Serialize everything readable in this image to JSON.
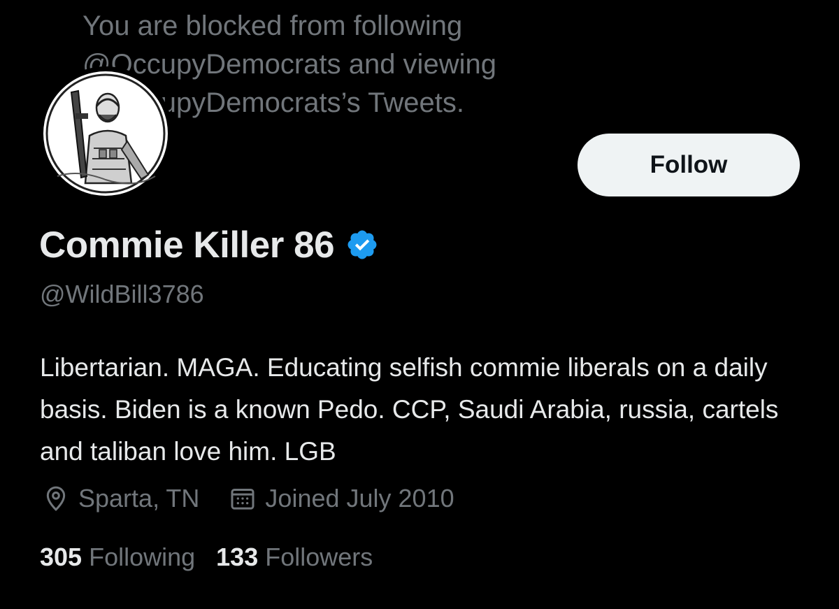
{
  "blocked_notice": {
    "lines": [
      "You are blocked from following",
      "@OccupyDemocrats and viewing",
      "@OccupyDemocrats’s Tweets."
    ]
  },
  "profile": {
    "avatar_icon": "profile-avatar-illustration",
    "follow_label": "Follow",
    "display_name": "Commie Killer 86",
    "verified_icon": "verified-badge-icon",
    "verified_color": "#1d9bf0",
    "handle": "@WildBill3786",
    "bio": "Libertarian. MAGA. Educating selfish commie liberals on a daily basis. Biden is a known Pedo. CCP, Saudi Arabia, russia, cartels and taliban love him. LGB",
    "location_icon": "location-pin-icon",
    "location": "Sparta, TN",
    "joined_icon": "calendar-icon",
    "joined": "Joined July 2010",
    "following_count": "305",
    "following_label": "Following",
    "followers_count": "133",
    "followers_label": "Followers"
  },
  "colors": {
    "background": "#000000",
    "primary_text": "#e7e9ea",
    "secondary_text": "#71767b",
    "button_bg": "#eff3f4"
  }
}
